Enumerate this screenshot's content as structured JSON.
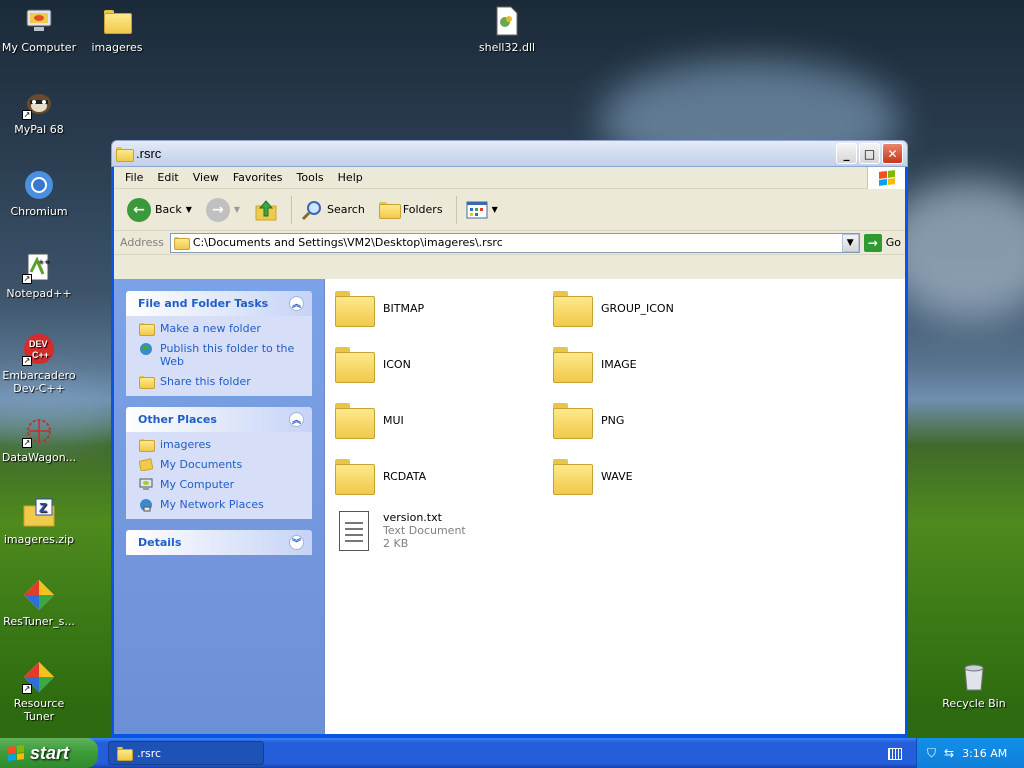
{
  "desktop": {
    "icons": [
      {
        "label": "My Computer"
      },
      {
        "label": "imageres"
      },
      {
        "label": "shell32.dll"
      },
      {
        "label": "MyPal 68"
      },
      {
        "label": "Chromium"
      },
      {
        "label": "Notepad++"
      },
      {
        "label": "Embarcadero Dev-C++"
      },
      {
        "label": "DataWagon..."
      },
      {
        "label": "imageres.zip"
      },
      {
        "label": "ResTuner_s..."
      },
      {
        "label": "Resource Tuner"
      },
      {
        "label": "Recycle Bin"
      }
    ]
  },
  "window": {
    "title": ".rsrc",
    "menu": [
      "File",
      "Edit",
      "View",
      "Favorites",
      "Tools",
      "Help"
    ],
    "toolbar": {
      "back": "Back",
      "search": "Search",
      "folders": "Folders"
    },
    "address": {
      "label": "Address",
      "value": "C:\\Documents and Settings\\VM2\\Desktop\\imageres\\.rsrc",
      "go": "Go"
    },
    "tasks": {
      "file_folder": {
        "title": "File and Folder Tasks",
        "items": [
          "Make a new folder",
          "Publish this folder to the Web",
          "Share this folder"
        ]
      },
      "other_places": {
        "title": "Other Places",
        "items": [
          "imageres",
          "My Documents",
          "My Computer",
          "My Network Places"
        ]
      },
      "details": {
        "title": "Details"
      }
    },
    "files": [
      {
        "name": "BITMAP",
        "type": "folder"
      },
      {
        "name": "GROUP_ICON",
        "type": "folder"
      },
      {
        "name": "ICON",
        "type": "folder"
      },
      {
        "name": "IMAGE",
        "type": "folder"
      },
      {
        "name": "MUI",
        "type": "folder"
      },
      {
        "name": "PNG",
        "type": "folder"
      },
      {
        "name": "RCDATA",
        "type": "folder"
      },
      {
        "name": "WAVE",
        "type": "folder"
      },
      {
        "name": "version.txt",
        "type": "file",
        "kind": "Text Document",
        "size": "2 KB"
      }
    ]
  },
  "taskbar": {
    "start_label": "start",
    "window_button": ".rsrc",
    "clock": "3:16 AM"
  },
  "colors": {
    "title_active": "#0a54e3",
    "task_pane": "#7ba2e7",
    "link": "#215dc6",
    "taskbar": "#245edb",
    "start": "#3c9b38"
  }
}
